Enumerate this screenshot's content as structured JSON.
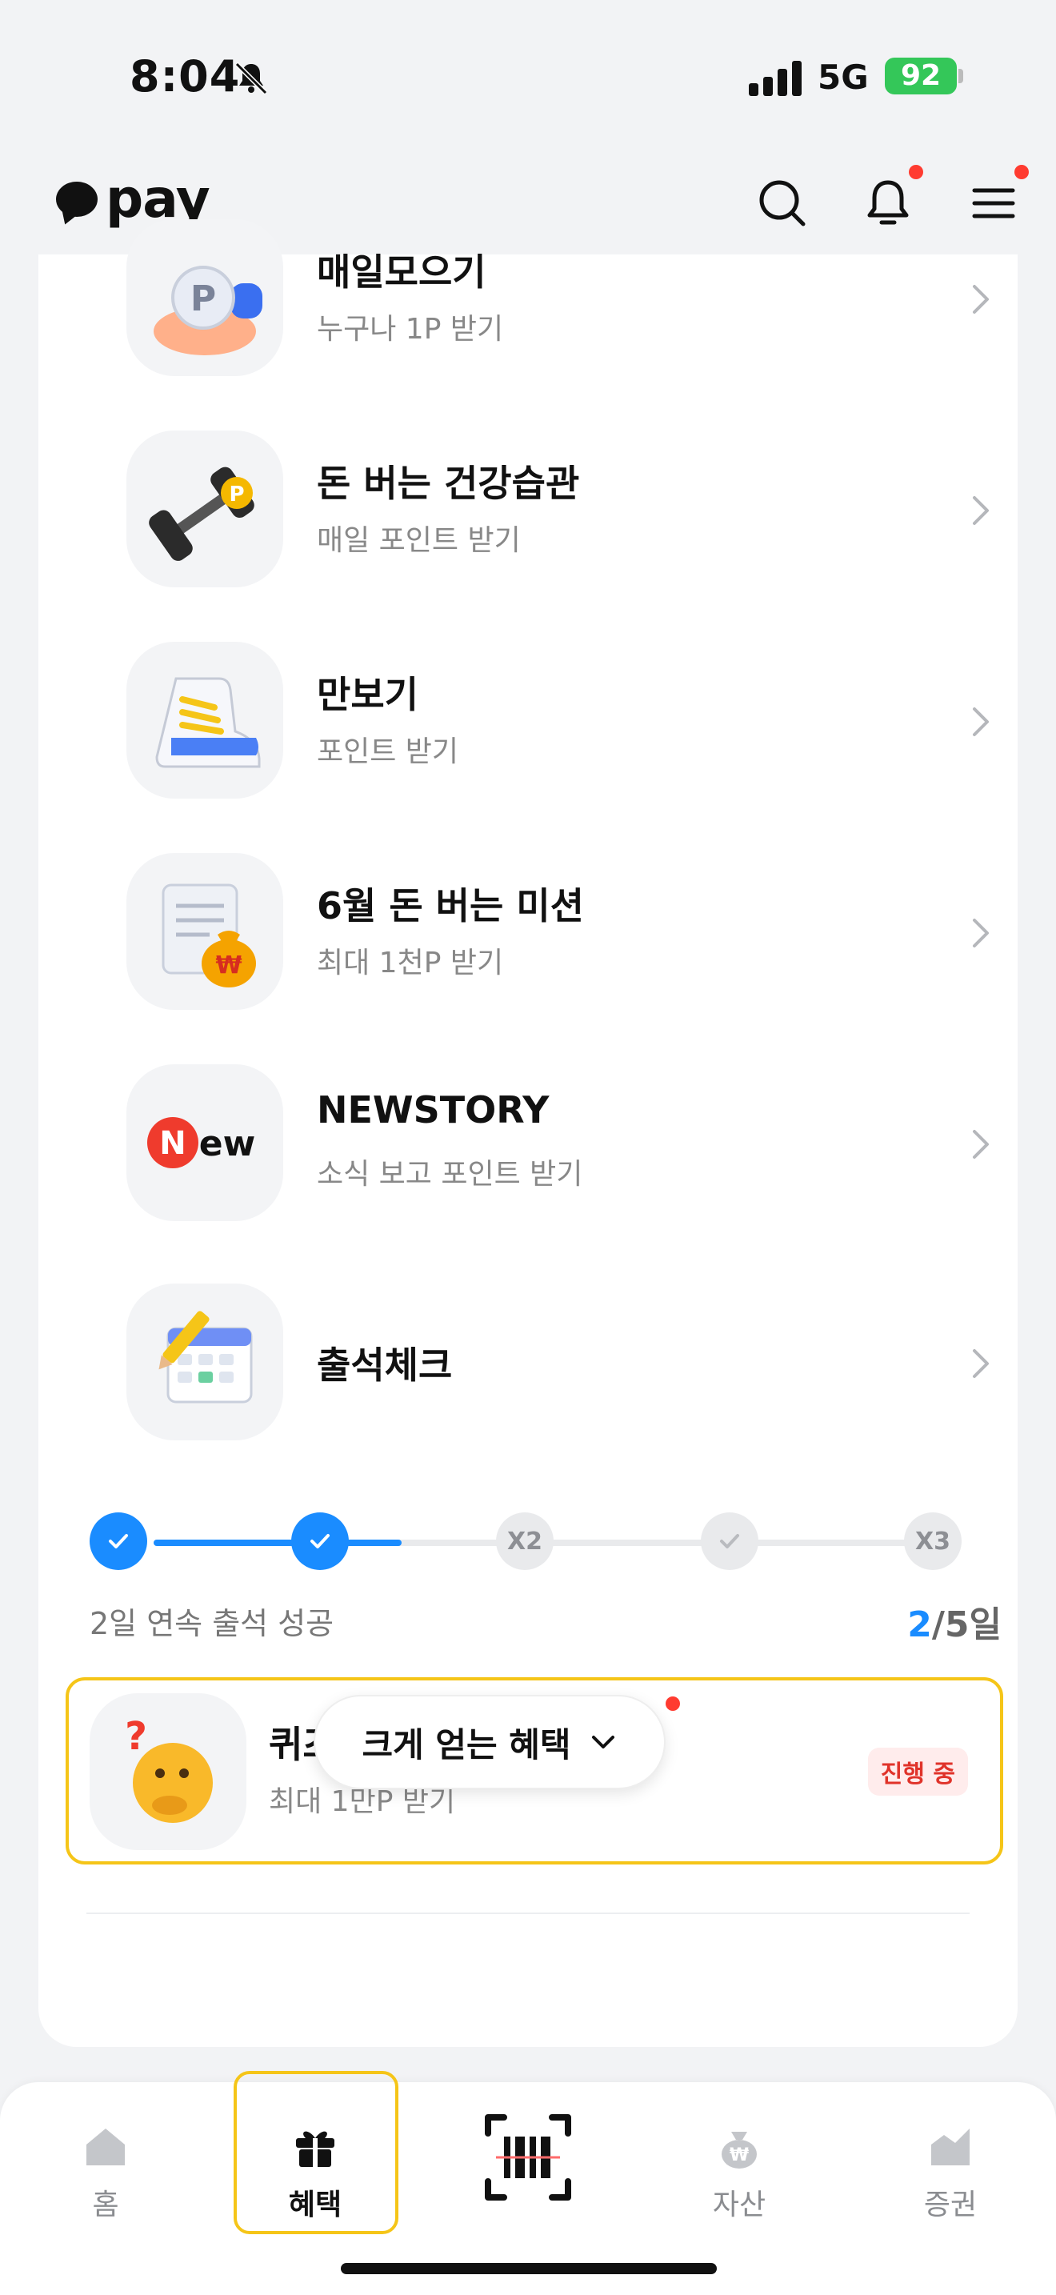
{
  "status_bar": {
    "time": "8:04",
    "network": "5G",
    "battery": "92"
  },
  "header": {
    "logo_text": "pay"
  },
  "items": [
    {
      "title": "매일모으기",
      "subtitle": "누구나 1P 받기"
    },
    {
      "title": "돈 버는 건강습관",
      "subtitle": "매일 포인트 받기"
    },
    {
      "title": "만보기",
      "subtitle": "포인트 받기"
    },
    {
      "title": "6월 돈 버는 미션",
      "subtitle": "최대 1천P 받기"
    },
    {
      "title": "NEWSTORY",
      "subtitle": "소식 보고 포인트 받기"
    },
    {
      "title": "출석체크",
      "subtitle": ""
    }
  ],
  "attendance": {
    "nodes": [
      "",
      "",
      "X2",
      "",
      "X3"
    ],
    "status": "2일 연속 출석 성공",
    "current": "2",
    "separator": "/",
    "total": "5일",
    "progress_days": 2,
    "goal_days": 5
  },
  "quiz": {
    "title": "퀴즈타임",
    "subtitle": "최대 1만P 받기",
    "badge": "진행 중"
  },
  "more_button": {
    "label": "크게 얻는 혜택"
  },
  "tabbar": [
    {
      "label": "홈"
    },
    {
      "label": "혜택"
    },
    {
      "label": ""
    },
    {
      "label": "자산"
    },
    {
      "label": "증권"
    }
  ],
  "colors": {
    "accent": "#1a8cff",
    "highlight": "#f5c518",
    "badge_red": "#e0332a",
    "notification": "#ff3b30"
  }
}
